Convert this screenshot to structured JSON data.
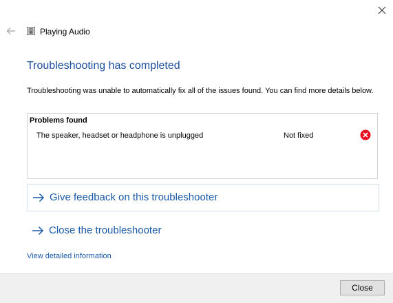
{
  "window": {
    "close_icon": "close-icon",
    "back_icon": "back-arrow-icon"
  },
  "header": {
    "app_icon": "speaker-icon",
    "title": "Playing Audio"
  },
  "main": {
    "heading": "Troubleshooting has completed",
    "description": "Troubleshooting was unable to automatically fix all of the issues found. You can find more details below.",
    "problems": {
      "header": "Problems found",
      "items": [
        {
          "text": "The speaker, headset or headphone is unplugged",
          "status": "Not fixed",
          "status_icon": "error-icon"
        }
      ]
    },
    "links": {
      "feedback": "Give feedback on this troubleshooter",
      "close_troubleshooter": "Close the troubleshooter",
      "arrow_icon": "arrow-right-icon"
    },
    "detail_link": "View detailed information"
  },
  "footer": {
    "close_label": "Close"
  },
  "colors": {
    "heading": "#1a4f9c",
    "link": "#1a5aa8",
    "error": "#e81123",
    "footer_bg": "#f0f0f0"
  }
}
